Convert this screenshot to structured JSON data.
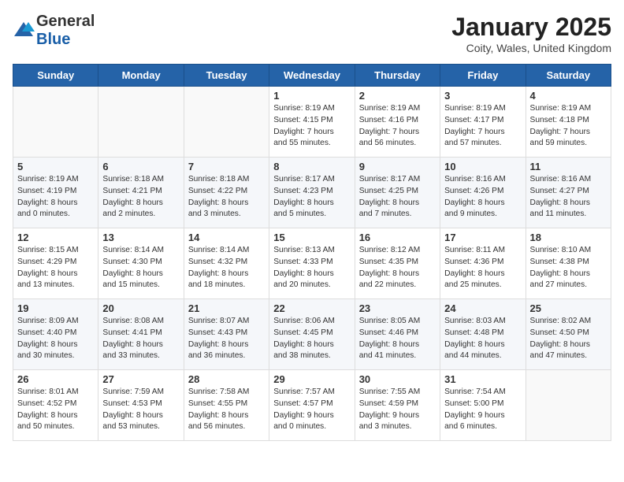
{
  "logo": {
    "general": "General",
    "blue": "Blue"
  },
  "title": "January 2025",
  "subtitle": "Coity, Wales, United Kingdom",
  "weekdays": [
    "Sunday",
    "Monday",
    "Tuesday",
    "Wednesday",
    "Thursday",
    "Friday",
    "Saturday"
  ],
  "weeks": [
    [
      {
        "day": "",
        "info": ""
      },
      {
        "day": "",
        "info": ""
      },
      {
        "day": "",
        "info": ""
      },
      {
        "day": "1",
        "info": "Sunrise: 8:19 AM\nSunset: 4:15 PM\nDaylight: 7 hours\nand 55 minutes."
      },
      {
        "day": "2",
        "info": "Sunrise: 8:19 AM\nSunset: 4:16 PM\nDaylight: 7 hours\nand 56 minutes."
      },
      {
        "day": "3",
        "info": "Sunrise: 8:19 AM\nSunset: 4:17 PM\nDaylight: 7 hours\nand 57 minutes."
      },
      {
        "day": "4",
        "info": "Sunrise: 8:19 AM\nSunset: 4:18 PM\nDaylight: 7 hours\nand 59 minutes."
      }
    ],
    [
      {
        "day": "5",
        "info": "Sunrise: 8:19 AM\nSunset: 4:19 PM\nDaylight: 8 hours\nand 0 minutes."
      },
      {
        "day": "6",
        "info": "Sunrise: 8:18 AM\nSunset: 4:21 PM\nDaylight: 8 hours\nand 2 minutes."
      },
      {
        "day": "7",
        "info": "Sunrise: 8:18 AM\nSunset: 4:22 PM\nDaylight: 8 hours\nand 3 minutes."
      },
      {
        "day": "8",
        "info": "Sunrise: 8:17 AM\nSunset: 4:23 PM\nDaylight: 8 hours\nand 5 minutes."
      },
      {
        "day": "9",
        "info": "Sunrise: 8:17 AM\nSunset: 4:25 PM\nDaylight: 8 hours\nand 7 minutes."
      },
      {
        "day": "10",
        "info": "Sunrise: 8:16 AM\nSunset: 4:26 PM\nDaylight: 8 hours\nand 9 minutes."
      },
      {
        "day": "11",
        "info": "Sunrise: 8:16 AM\nSunset: 4:27 PM\nDaylight: 8 hours\nand 11 minutes."
      }
    ],
    [
      {
        "day": "12",
        "info": "Sunrise: 8:15 AM\nSunset: 4:29 PM\nDaylight: 8 hours\nand 13 minutes."
      },
      {
        "day": "13",
        "info": "Sunrise: 8:14 AM\nSunset: 4:30 PM\nDaylight: 8 hours\nand 15 minutes."
      },
      {
        "day": "14",
        "info": "Sunrise: 8:14 AM\nSunset: 4:32 PM\nDaylight: 8 hours\nand 18 minutes."
      },
      {
        "day": "15",
        "info": "Sunrise: 8:13 AM\nSunset: 4:33 PM\nDaylight: 8 hours\nand 20 minutes."
      },
      {
        "day": "16",
        "info": "Sunrise: 8:12 AM\nSunset: 4:35 PM\nDaylight: 8 hours\nand 22 minutes."
      },
      {
        "day": "17",
        "info": "Sunrise: 8:11 AM\nSunset: 4:36 PM\nDaylight: 8 hours\nand 25 minutes."
      },
      {
        "day": "18",
        "info": "Sunrise: 8:10 AM\nSunset: 4:38 PM\nDaylight: 8 hours\nand 27 minutes."
      }
    ],
    [
      {
        "day": "19",
        "info": "Sunrise: 8:09 AM\nSunset: 4:40 PM\nDaylight: 8 hours\nand 30 minutes."
      },
      {
        "day": "20",
        "info": "Sunrise: 8:08 AM\nSunset: 4:41 PM\nDaylight: 8 hours\nand 33 minutes."
      },
      {
        "day": "21",
        "info": "Sunrise: 8:07 AM\nSunset: 4:43 PM\nDaylight: 8 hours\nand 36 minutes."
      },
      {
        "day": "22",
        "info": "Sunrise: 8:06 AM\nSunset: 4:45 PM\nDaylight: 8 hours\nand 38 minutes."
      },
      {
        "day": "23",
        "info": "Sunrise: 8:05 AM\nSunset: 4:46 PM\nDaylight: 8 hours\nand 41 minutes."
      },
      {
        "day": "24",
        "info": "Sunrise: 8:03 AM\nSunset: 4:48 PM\nDaylight: 8 hours\nand 44 minutes."
      },
      {
        "day": "25",
        "info": "Sunrise: 8:02 AM\nSunset: 4:50 PM\nDaylight: 8 hours\nand 47 minutes."
      }
    ],
    [
      {
        "day": "26",
        "info": "Sunrise: 8:01 AM\nSunset: 4:52 PM\nDaylight: 8 hours\nand 50 minutes."
      },
      {
        "day": "27",
        "info": "Sunrise: 7:59 AM\nSunset: 4:53 PM\nDaylight: 8 hours\nand 53 minutes."
      },
      {
        "day": "28",
        "info": "Sunrise: 7:58 AM\nSunset: 4:55 PM\nDaylight: 8 hours\nand 56 minutes."
      },
      {
        "day": "29",
        "info": "Sunrise: 7:57 AM\nSunset: 4:57 PM\nDaylight: 9 hours\nand 0 minutes."
      },
      {
        "day": "30",
        "info": "Sunrise: 7:55 AM\nSunset: 4:59 PM\nDaylight: 9 hours\nand 3 minutes."
      },
      {
        "day": "31",
        "info": "Sunrise: 7:54 AM\nSunset: 5:00 PM\nDaylight: 9 hours\nand 6 minutes."
      },
      {
        "day": "",
        "info": ""
      }
    ]
  ]
}
